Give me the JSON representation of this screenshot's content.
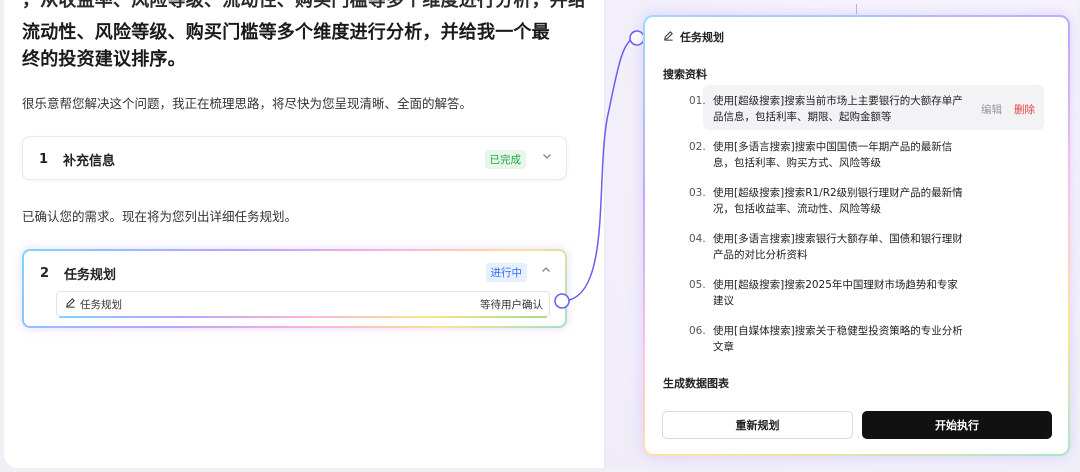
{
  "question": {
    "cut_line": "，从收益率、风险等级、流动性、购买门槛等多个维度进行分析，并给",
    "line1": "流动性、风险等级、购买门槛等多个维度进行分析，并给我一个最",
    "line2": "终的投资建议排序。"
  },
  "assistant": {
    "intro": "很乐意帮您解决这个问题，我正在梳理思路，将尽快为您呈现清晰、全面的解答。",
    "confirm": "已确认您的需求。现在将为您列出详细任务规划。"
  },
  "cards": [
    {
      "num": "1",
      "title": "补充信息",
      "status": "已完成"
    },
    {
      "num": "2",
      "title": "任务规划",
      "status": "进行中",
      "sub": {
        "label": "任务规划",
        "status": "等待用户确认"
      }
    }
  ],
  "panel": {
    "title": "任务规划",
    "section_search": "搜索资料",
    "steps": [
      {
        "num": "01.",
        "text": "使用[超级搜索]搜索当前市场上主要银行的大额存单产品信息，包括利率、期限、起购金额等"
      },
      {
        "num": "02.",
        "text": "使用[多语言搜索]搜索中国国债一年期产品的最新信息，包括利率、购买方式、风险等级"
      },
      {
        "num": "03.",
        "text": "使用[超级搜索]搜索R1/R2级别银行理财产品的最新情况，包括收益率、流动性、风险等级"
      },
      {
        "num": "04.",
        "text": "使用[多语言搜索]搜索银行大额存单、国债和银行理财产品的对比分析资料"
      },
      {
        "num": "05.",
        "text": "使用[超级搜索]搜索2025年中国理财市场趋势和专家建议"
      },
      {
        "num": "06.",
        "text": "使用[自媒体搜索]搜索关于稳健型投资策略的专业分析文章"
      }
    ],
    "edit_label": "编辑",
    "delete_label": "删除",
    "section_chart": "生成数据图表",
    "replan_label": "重新规划",
    "run_label": "开始执行"
  },
  "icons": {
    "pencil": "pencil-icon",
    "chevron_down": "chevron-down-icon",
    "chevron_up": "chevron-up-icon"
  },
  "colors": {
    "done_green": "#22a24a",
    "doing_blue": "#2f6bff",
    "delete_red": "#e5423a",
    "connector": "#6b5cf0"
  }
}
